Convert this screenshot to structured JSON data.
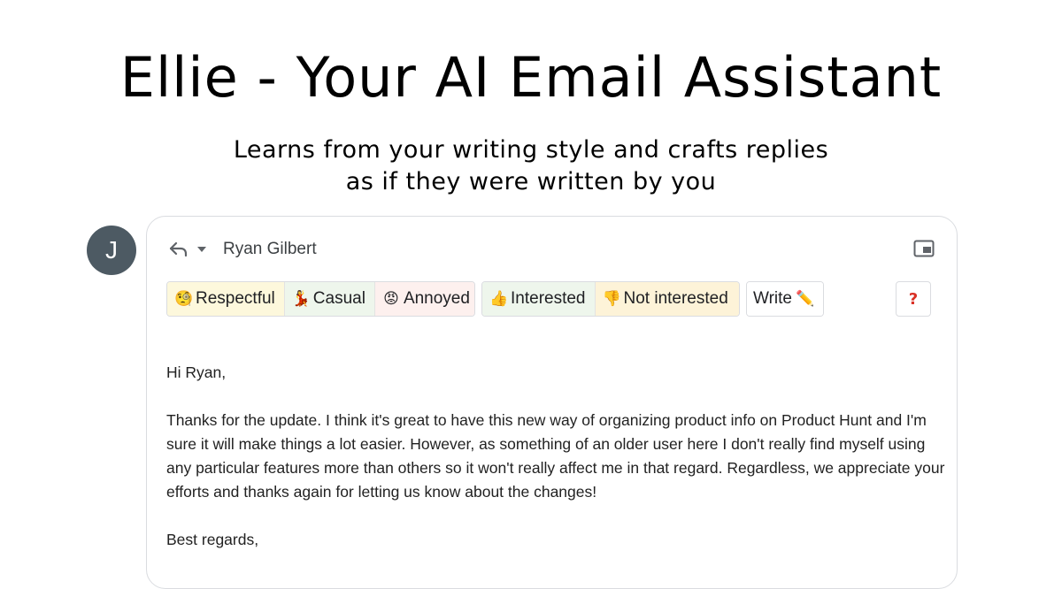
{
  "hero": {
    "title": "Ellie - Your AI Email Assistant",
    "subtitle_line1": "Learns from your writing style and crafts replies",
    "subtitle_line2": "as if they were written by you"
  },
  "avatar": {
    "initial": "J",
    "color": "#4d5a63"
  },
  "compose": {
    "reply_icon": "reply-arrow-icon",
    "dropdown_icon": "caret-down-icon",
    "recipient": "Ryan Gilbert",
    "popout_icon": "popout-window-icon",
    "tone_groups": [
      {
        "options": [
          {
            "emoji": "🧐",
            "label": "Respectful",
            "bg": "#fdf8dc"
          },
          {
            "emoji": "💃",
            "label": "Casual",
            "bg": "#eef6ec"
          },
          {
            "emoji": "😡",
            "label": "Annoyed",
            "bg": "#fdf0ee"
          }
        ]
      },
      {
        "options": [
          {
            "emoji": "👍",
            "label": "Interested",
            "bg": "#eef6ec"
          },
          {
            "emoji": "👎",
            "label": "Not interested",
            "bg": "#fdf3d8"
          }
        ]
      },
      {
        "options": [
          {
            "emoji": "✏️",
            "label": "Write",
            "bg": "#ffffff"
          }
        ]
      }
    ],
    "help_label": "?",
    "help_color": "#d93025"
  },
  "email": {
    "greeting": "Hi Ryan,",
    "paragraph": "Thanks for the update. I think it's great to have this new way of organizing product info on Product Hunt and I'm sure it will make things a lot easier. However, as something of an older user here I don't really find myself using any particular features more than others so it won't really affect me in that regard. Regardless, we appreciate your efforts and thanks again for letting us know about the changes!",
    "signoff": "Best regards,"
  }
}
